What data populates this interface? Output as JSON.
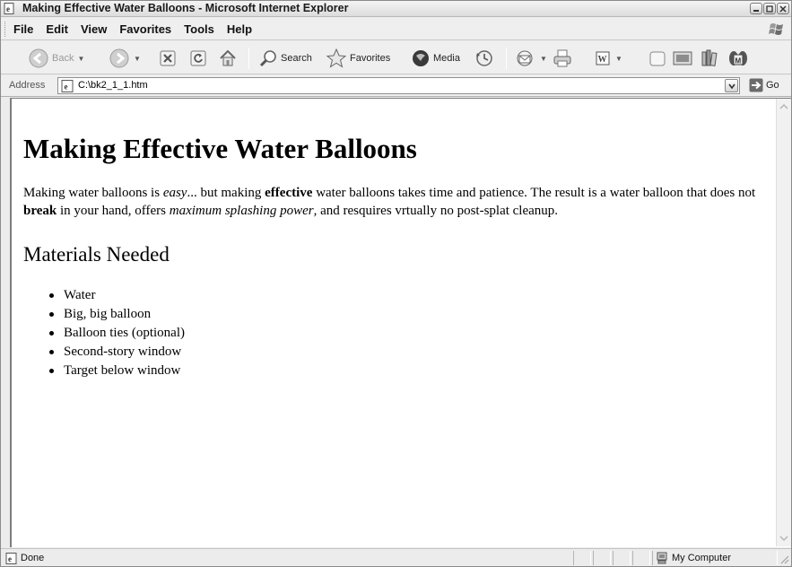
{
  "window": {
    "title": "Making Effective Water Balloons - Microsoft Internet Explorer"
  },
  "menu": [
    "File",
    "Edit",
    "View",
    "Favorites",
    "Tools",
    "Help"
  ],
  "toolbar": {
    "back": "Back",
    "search": "Search",
    "favorites": "Favorites",
    "media": "Media"
  },
  "address": {
    "label": "Address",
    "url": "C:\\bk2_1_1.htm",
    "go": "Go"
  },
  "page": {
    "heading": "Making Effective Water Balloons",
    "intro": {
      "t1": "Making water balloons is ",
      "em1": "easy",
      "t2": "... but making ",
      "strong1": "effective",
      "t3": " water balloons takes time and patience. The result is a water balloon that does not ",
      "strong2": "break",
      "t4": " in your hand, offers ",
      "em2": "maximum splashing power",
      "t5": ", and resquires vrtually no post-splat cleanup."
    },
    "subheading": "Materials Needed",
    "materials": [
      "Water",
      "Big, big balloon",
      "Balloon ties (optional)",
      "Second-story window",
      "Target below window"
    ]
  },
  "status": {
    "text": "Done",
    "zone": "My Computer"
  }
}
